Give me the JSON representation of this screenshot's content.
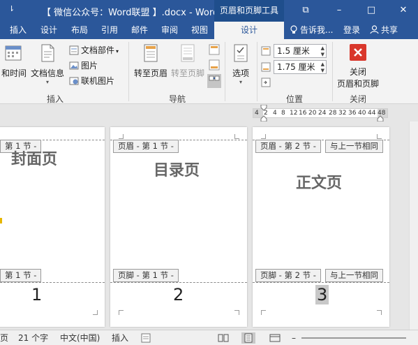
{
  "titlebar": {
    "quick_access_arrow": "⇂",
    "doc_title": "【 微信公众号：Word联盟 】.docx - Word",
    "context_tab": "页眉和页脚工具",
    "restore_icon": "⧉",
    "minimize_icon": "–",
    "maximize_icon": "□",
    "close_icon": "✕"
  },
  "ribbon_tabs": [
    {
      "label": "插入"
    },
    {
      "label": "设计"
    },
    {
      "label": "布局"
    },
    {
      "label": "引用"
    },
    {
      "label": "邮件"
    },
    {
      "label": "审阅"
    },
    {
      "label": "视图"
    },
    {
      "label": "设计"
    }
  ],
  "tell_me": "告诉我...",
  "login": "登录",
  "share": "共享",
  "ribbon": {
    "insert": {
      "date_time": "和时间",
      "doc_info": "文档信息",
      "doc_parts": "文档部件",
      "picture": "图片",
      "online_picture": "联机图片",
      "group_label": "插入"
    },
    "navigation": {
      "goto_header": "转至页眉",
      "goto_footer": "转至页脚",
      "group_label": "导航"
    },
    "options": {
      "label": "选项",
      "group_label": ""
    },
    "position": {
      "header_distance": "1.5 厘米",
      "footer_distance": "1.75 厘米",
      "group_label": "位置"
    },
    "close": {
      "label_line1": "关闭",
      "label_line2": "页眉和页脚",
      "group_label": "关闭"
    }
  },
  "ruler": {
    "labels": [
      "4",
      "2",
      "4",
      "8",
      "12",
      "16",
      "20",
      "24",
      "28",
      "32",
      "36",
      "40",
      "44",
      "48"
    ]
  },
  "pages": [
    {
      "title": "封面页",
      "header_tag": "第 1 节 -",
      "footer_tag": "第 1 节 -",
      "number": "1"
    },
    {
      "title": "目录页",
      "header_tag": "页眉 - 第 1 节 -",
      "footer_tag": "页脚 - 第 1 节 -",
      "number": "2"
    },
    {
      "title": "正文页",
      "header_tag": "页眉 - 第 2 节 -",
      "header_link": "与上一节相同",
      "footer_tag": "页脚 - 第 2 节 -",
      "footer_link": "与上一节相同",
      "number": "3"
    }
  ],
  "status": {
    "page": "页",
    "words": "21 个字",
    "language": "中文(中国)",
    "mode": "插入"
  }
}
